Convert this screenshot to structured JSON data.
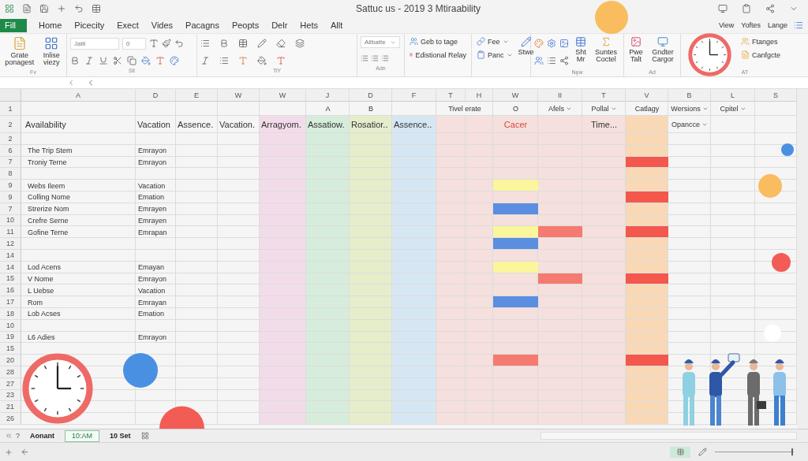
{
  "title_bar": {
    "title": "Sattuc us - 2019 3 Mtiraability"
  },
  "menu": {
    "file": "Fill",
    "tabs": [
      "Home",
      "Picecity",
      "Exect",
      "Vides",
      "Pacagns",
      "Peopts",
      "Delr",
      "Hets",
      "Allt"
    ],
    "right": [
      "View",
      "Yoftes",
      "Lange"
    ]
  },
  "ribbon": {
    "groups": [
      {
        "kind": "clipboard",
        "label": "Fv",
        "items": [
          "Grate ponagest",
          "Inlise viezy"
        ]
      },
      {
        "kind": "font",
        "label": "Sil",
        "font": "Jatll",
        "size": "0"
      },
      {
        "kind": "alignment",
        "label": "TiY"
      },
      {
        "kind": "styles",
        "label": "Adn",
        "style": "Allbatte"
      },
      {
        "kind": "links",
        "items": [
          "Geb to tage",
          "Edistional Relay"
        ]
      },
      {
        "kind": "cells",
        "items": [
          "Fee",
          "Panc",
          "Stwe"
        ]
      },
      {
        "kind": "insert",
        "label": "Nęw",
        "items": [
          "Sht Mr",
          "Suntes Coctel"
        ]
      },
      {
        "kind": "tools",
        "label": "Ad",
        "items": [
          "Pwe Talt",
          "Gndter Cargor"
        ]
      },
      {
        "kind": "editing",
        "label": "AT",
        "items": [
          "Ftanges",
          "Canfgcte"
        ]
      }
    ]
  },
  "grid": {
    "columns": [
      {
        "letter": "A"
      },
      {
        "letter": "D"
      },
      {
        "letter": "E"
      },
      {
        "letter": "W"
      },
      {
        "letter": "W",
        "color": "#f3dcea"
      },
      {
        "letter": "J",
        "color": "#d6eddb"
      },
      {
        "letter": "D",
        "color": "#e5edcb"
      },
      {
        "letter": "F",
        "color": "#d6e7f4"
      },
      {
        "letter": "T",
        "color": "#f5e0dd"
      },
      {
        "letter": "H",
        "color": "#f5e0dd"
      },
      {
        "letter": "W",
        "color": "#f5e0dd"
      },
      {
        "letter": "II",
        "color": "#f5e0dd"
      },
      {
        "letter": "T",
        "color": "#f5e0dd"
      },
      {
        "letter": "V",
        "color": "#f9d8b6"
      },
      {
        "letter": "B"
      },
      {
        "letter": "L"
      },
      {
        "letter": "S"
      }
    ],
    "header_rows": [
      {
        "label": "1",
        "cells": [
          null,
          null,
          null,
          null,
          null,
          {
            "text": "A"
          },
          {
            "text": "B"
          },
          null,
          {
            "text": "Tivel erate",
            "merged": true
          },
          {
            "text": "O"
          },
          {
            "text": "Afels",
            "dropdown": true
          },
          {
            "text": "Pollal",
            "dropdown": true
          },
          {
            "text": "Catlagy"
          },
          {
            "text": "Wersions",
            "dropdown": true
          },
          {
            "text": "Cpitel",
            "dropdown": true
          },
          null
        ]
      },
      {
        "label": "2",
        "cells": [
          {
            "text": "Availability"
          },
          {
            "text": "Vacation"
          },
          {
            "text": "Assence."
          },
          {
            "text": "Vacation."
          },
          {
            "text": "Arragyom."
          },
          {
            "text": "Assatiow."
          },
          {
            "text": "Rosatior.."
          },
          {
            "text": "Assence.."
          },
          null,
          null,
          {
            "text": "Cacer",
            "color": "#d9463e"
          },
          null,
          {
            "text": "Time..."
          },
          null,
          {
            "text": "Opancce",
            "dropdown": true
          },
          null,
          null
        ]
      }
    ],
    "rows": [
      {
        "label": "2"
      },
      {
        "label": "6",
        "name": "The Trip Stem",
        "type": "Emrayon"
      },
      {
        "label": "7",
        "name": "Troniy Terne",
        "type": "Emrayon",
        "catlagy": {
          "color": "#f4574b"
        }
      },
      {
        "label": "8"
      },
      {
        "label": "9",
        "name": "Webs Ileem",
        "type": "Vacation",
        "o": {
          "color": "#fbf59c"
        }
      },
      {
        "label": "9",
        "name": "Colling Nome",
        "type": "Emation",
        "catlagy": {
          "color": "#f4574b"
        }
      },
      {
        "label": "7",
        "name": "Strerize Nom",
        "type": "Emrayen",
        "o": {
          "color": "#5b8ee0"
        }
      },
      {
        "label": "10",
        "name": "Crefre Serne",
        "type": "Emrayen"
      },
      {
        "label": "11",
        "name": "Gofine Terne",
        "type": "Emrapan",
        "o": {
          "color": "#fbf59c"
        },
        "afels": {
          "color": "#f57a70"
        },
        "catlagy": {
          "color": "#f4574b"
        }
      },
      {
        "label": "12",
        "o": {
          "color": "#5b8ee0"
        }
      },
      {
        "label": "14"
      },
      {
        "label": "14",
        "name": "Lod Acens",
        "type": "Emayan",
        "o": {
          "color": "#fbf59c"
        }
      },
      {
        "label": "15",
        "name": "V Nome",
        "type": "Emrayon",
        "afels": {
          "color": "#f57a70"
        },
        "catlagy": {
          "color": "#f4574b"
        }
      },
      {
        "label": "16",
        "name": "L Uebse",
        "type": "Vacation"
      },
      {
        "label": "17",
        "name": "Rom",
        "type": "Emrayan",
        "o": {
          "color": "#5b8ee0"
        }
      },
      {
        "label": "18",
        "name": "Lob Acses",
        "type": "Emation"
      },
      {
        "label": "10"
      },
      {
        "label": "19",
        "name": "L6 Adies",
        "type": "Emrayon"
      },
      {
        "label": "15"
      },
      {
        "label": "20",
        "o": {
          "color": "#f57a70"
        },
        "catlagy": {
          "color": "#f4574b"
        }
      },
      {
        "label": "28"
      },
      {
        "label": "27"
      },
      {
        "label": "23"
      },
      {
        "label": "21"
      },
      {
        "label": "26"
      }
    ]
  },
  "sheet_bar": {
    "help": "?",
    "sheets": [
      {
        "label": "Aonant",
        "selected": false
      },
      {
        "label": "10:AM",
        "selected": true
      },
      {
        "label": "10 Set",
        "selected": false
      }
    ]
  },
  "status_bar": {
    "zoom": {
      "level": 0.97
    }
  }
}
